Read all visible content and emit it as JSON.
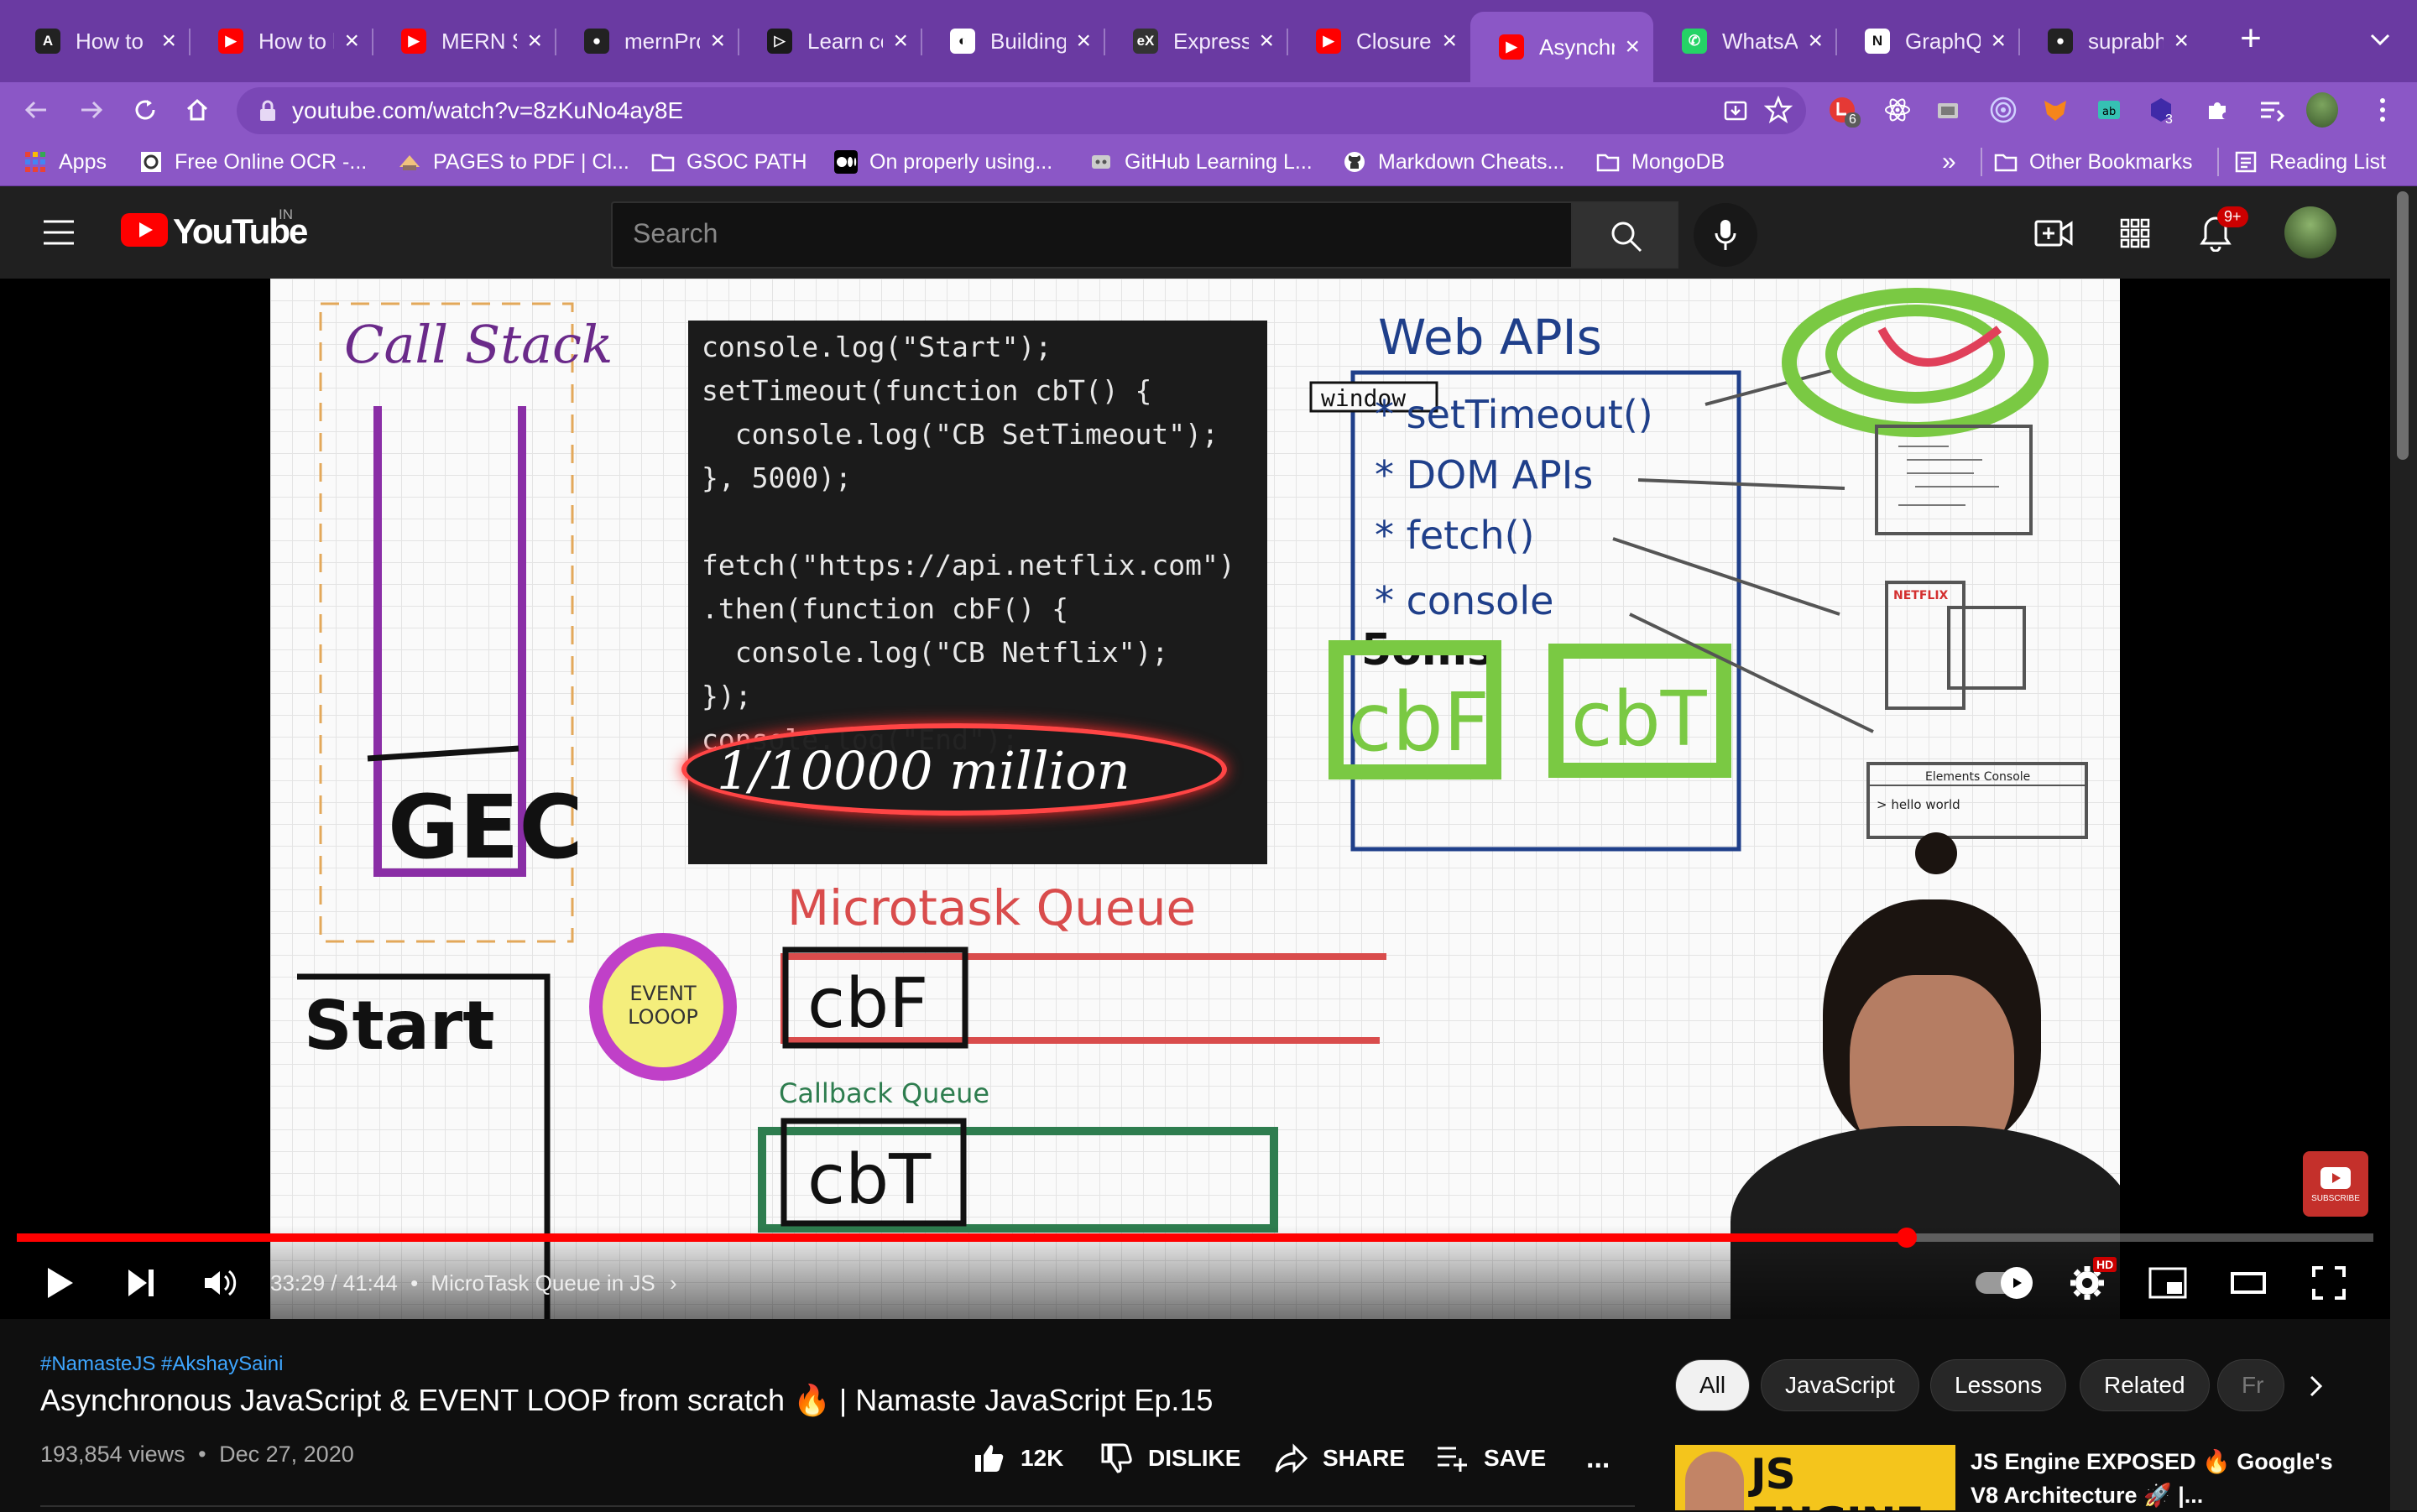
{
  "colors": {
    "tabbar": "#6a3aa2",
    "toolbar": "#8b57c6",
    "youtube_red": "#ff0000",
    "link_blue": "#3ea6ff"
  },
  "tabs": [
    {
      "label": "How to",
      "icon": "app-icon"
    },
    {
      "label": "How to l",
      "icon": "youtube-icon"
    },
    {
      "label": "MERN S",
      "icon": "youtube-icon"
    },
    {
      "label": "mernPro",
      "icon": "github-icon"
    },
    {
      "label": "Learn co",
      "icon": "code-icon"
    },
    {
      "label": "Building",
      "icon": "globe-icon"
    },
    {
      "label": "Express",
      "icon": "ex-icon"
    },
    {
      "label": "Closure",
      "icon": "youtube-icon"
    },
    {
      "label": "Asynchr",
      "icon": "youtube-icon",
      "active": true
    },
    {
      "label": "WhatsA",
      "icon": "whatsapp-icon"
    },
    {
      "label": "GraphQ",
      "icon": "notion-icon"
    },
    {
      "label": "suprabh",
      "icon": "github-icon"
    }
  ],
  "address_bar": {
    "url": "youtube.com/watch?v=8zKuNo4ay8E"
  },
  "extension_badges": {
    "first": "6",
    "second": "3"
  },
  "bookmarks": [
    "Apps",
    "Free Online OCR -...",
    "PAGES to PDF | Cl...",
    "GSOC PATH",
    "On properly using...",
    "GitHub Learning L...",
    "Markdown Cheats...",
    "MongoDB"
  ],
  "bookmarks_right": {
    "more": "»",
    "other": "Other Bookmarks",
    "reading": "Reading List"
  },
  "youtube": {
    "logo_text": "YouTube",
    "country": "IN",
    "search_placeholder": "Search",
    "notification_count": "9+"
  },
  "video": {
    "code": {
      "line1": "console.log(\"Start\");",
      "line3": "setTimeout(function cbT() {",
      "line4": "  console.log(\"CB SetTimeout\");",
      "line5": "}, 5000);",
      "line7": "fetch(\"https://api.netflix.com\")",
      "line8": ".then(function cbF() {",
      "line9": "  console.log(\"CB Netflix\");",
      "line10": "});",
      "line11": "console.log(\"End\");"
    },
    "whiteboard": {
      "call_stack": "Call Stack",
      "gec": "GEC",
      "web_apis": "Web APIs",
      "window": "window",
      "api1": "* setTimeout()",
      "api2": "* DOM APIs",
      "api3": "* fetch()",
      "api4": "* console",
      "timer": "5oms",
      "cbf": "cbF",
      "cbt": "cbT",
      "million": "1/10000 million",
      "microtask_queue": "Microtask Queue",
      "callback_queue": "Callback Queue",
      "event_loop_1": "EVENT",
      "event_loop_2": "LOOOP",
      "console_start": "Start",
      "devtools_tabs": "Elements   Console",
      "devtools_out": "> hello world",
      "netflix": "NETFLIX",
      "subscribe": "SUBSCRIBE"
    },
    "time_current": "33:29",
    "time_total": "41:44",
    "chapter": "MicroTask Queue in JS",
    "progress": 0.802,
    "hd_badge": "HD"
  },
  "meta": {
    "hashtags": "#NamasteJS #AkshaySaini",
    "title": "Asynchronous JavaScript & EVENT LOOP from scratch 🔥  | Namaste JavaScript Ep.15",
    "views": "193,854 views",
    "date": "Dec 27, 2020",
    "likes": "12K",
    "dislike": "DISLIKE",
    "share": "SHARE",
    "save": "SAVE",
    "more": "..."
  },
  "chips": [
    "All",
    "JavaScript",
    "Lessons",
    "Related",
    "Fr"
  ],
  "recommendation": {
    "thumb_text": "JS ENGINE",
    "title": "JS Engine EXPOSED 🔥 Google's V8 Architecture 🚀 |..."
  }
}
